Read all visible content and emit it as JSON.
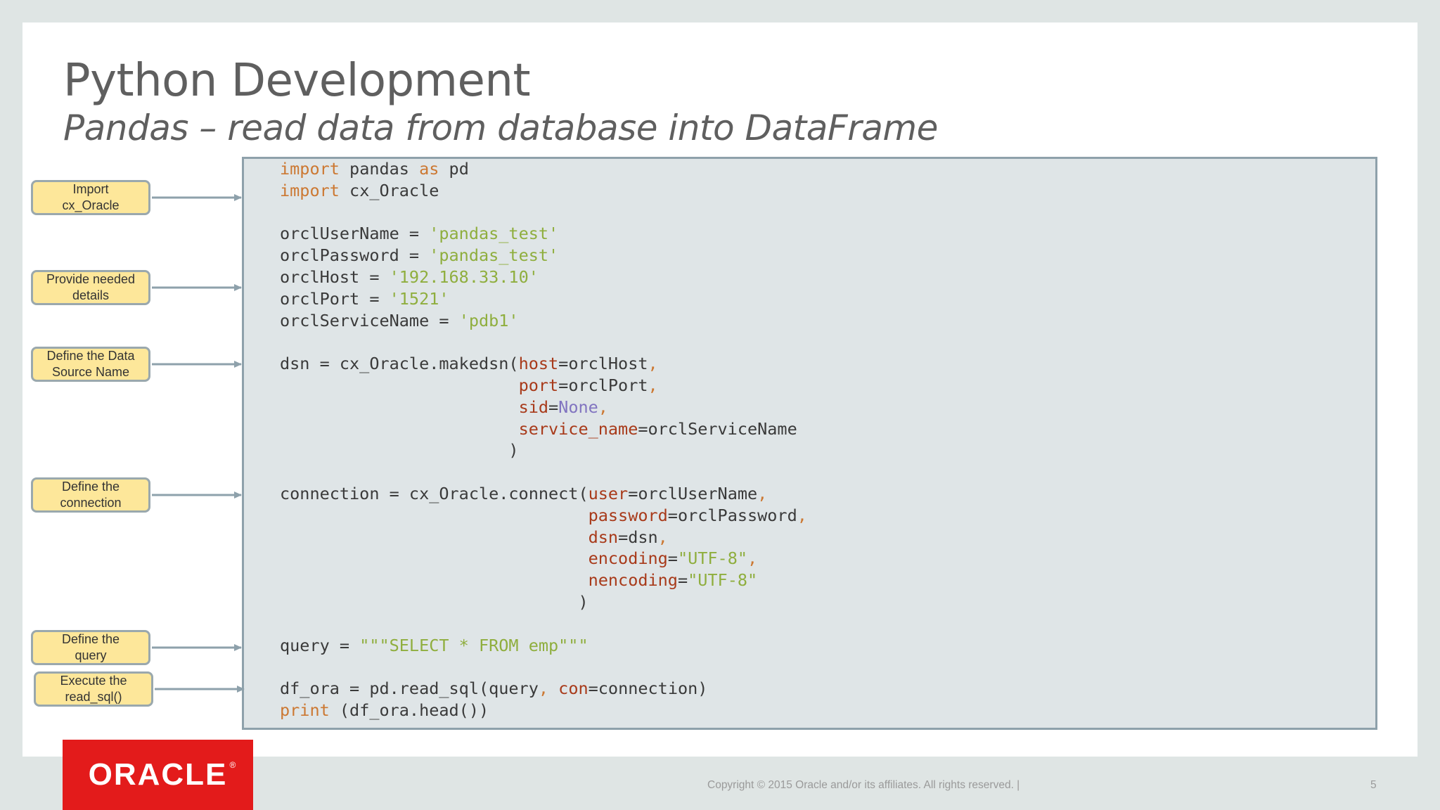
{
  "slide": {
    "title": "Python Development",
    "subtitle": "Pandas – read data from database into DataFrame",
    "footer": {
      "logo_text": "ORACLE",
      "logo_mark": "®",
      "copyright": "Copyright © 2015 Oracle and/or its affiliates. All rights reserved.  |",
      "page_number": "5"
    }
  },
  "callouts": [
    {
      "line1": "Import",
      "line2": "cx_Oracle"
    },
    {
      "line1": "Provide needed",
      "line2": "details"
    },
    {
      "line1": "Define the Data",
      "line2": "Source Name"
    },
    {
      "line1": "Define the",
      "line2": "connection"
    },
    {
      "line1": "Define the",
      "line2": "query"
    },
    {
      "line1": "Execute the",
      "line2": "read_sql()"
    }
  ],
  "code": {
    "kw_import": "import",
    "kw_as": "as",
    "kw_print": "print",
    "mod_pandas": "pandas",
    "alias_pd": "pd",
    "mod_cx": "cx_Oracle",
    "var_user": "orclUserName",
    "var_password": "orclPassword",
    "var_host": "orclHost",
    "var_port": "orclPort",
    "var_service": "orclServiceName",
    "eq": " = ",
    "str_user": "'pandas_test'",
    "str_password": "'pandas_test'",
    "str_host": "'192.168.33.10'",
    "str_port": "'1521'",
    "str_service": "'pdb1'",
    "dsn_call": "dsn = cx_Oracle.makedsn(",
    "p_host": "host",
    "p_port": "port",
    "p_sid": "sid",
    "val_none": "None",
    "p_service_name": "service_name",
    "val_dsn_host": "orclHost",
    "val_dsn_port": "orclPort",
    "val_dsn_service": "orclServiceName",
    "comma": ",",
    "close_paren": ")",
    "conn_call": "connection = cx_Oracle.connect(",
    "p_user": "user",
    "p_password": "password",
    "p_dsn": "dsn",
    "p_encoding": "encoding",
    "p_nencoding": "nencoding",
    "val_conn_user": "orclUserName",
    "val_conn_password": "orclPassword",
    "val_conn_dsn": "dsn",
    "str_utf8_a": "\"UTF-8\"",
    "str_utf8_b": "\"UTF-8\"",
    "query_assign": "query = ",
    "str_query": "\"\"\"SELECT * FROM emp\"\"\"",
    "read_call": "df_ora = pd.read_sql(query",
    "p_con": "con",
    "val_con": "connection)",
    "print_arg": " (df_ora.head())"
  }
}
